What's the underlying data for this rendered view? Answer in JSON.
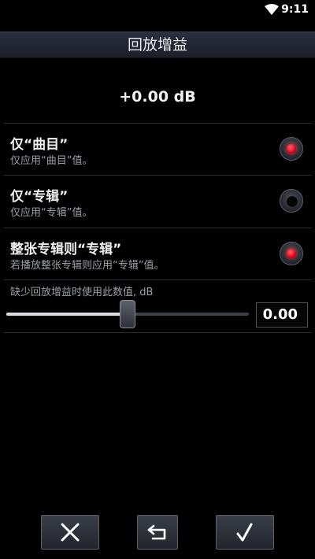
{
  "status_bar": {
    "time": "9:11",
    "wifi_icon": "wifi-icon"
  },
  "header": {
    "title": "回放增益"
  },
  "gain": {
    "value": "+0.00 dB"
  },
  "options": [
    {
      "title": "仅“曲目”",
      "subtitle": "仅应用“曲目”值。",
      "selected": true
    },
    {
      "title": "仅“专辑”",
      "subtitle": "仅应用“专辑”值。",
      "selected": false
    },
    {
      "title": "整张专辑则“专辑”",
      "subtitle": "若播放整张专辑则应用“专辑”值。",
      "selected": true
    }
  ],
  "fallback": {
    "label": "缺少回放增益时使用此数值, dB",
    "value": "0.00",
    "slider_fraction": 0.5
  },
  "buttons": {
    "cancel_icon": "close-icon",
    "reset_icon": "undo-icon",
    "confirm_icon": "checkmark-icon"
  },
  "colors": {
    "accent": "#e3001a",
    "background": "#000000",
    "titlebar": "#232733"
  }
}
